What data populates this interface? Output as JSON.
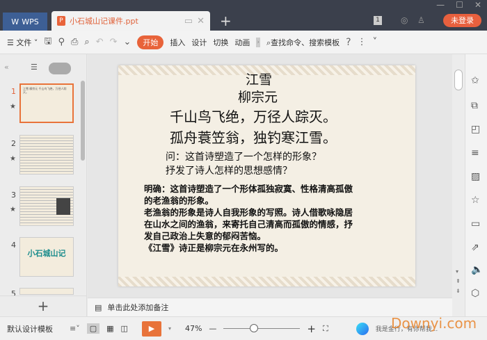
{
  "titlebar": {
    "wps_label": "WPS",
    "doc_name": "小石城山记课件.ppt",
    "badge": "1",
    "login": "未登录"
  },
  "toolbar": {
    "file": "文件",
    "start": "开始",
    "insert": "插入",
    "design": "设计",
    "transition": "切换",
    "animation": "动画",
    "search": "查找命令、搜索模板",
    "help": "?"
  },
  "slides_pane": {
    "thumbnails": [
      {
        "num": "1",
        "text": "江雪 柳宗元 千山鸟飞绝，万径人踪灭。"
      },
      {
        "num": "2",
        "text": ""
      },
      {
        "num": "3",
        "text": ""
      },
      {
        "num": "4",
        "text": "小石城山记"
      }
    ],
    "next_num": "5",
    "add": "+"
  },
  "slide": {
    "title": "江雪",
    "author": "柳宗元",
    "line1": "千山鸟飞绝，万径人踪灭。",
    "line2": "孤舟蓑笠翁，独钓寒江雪。",
    "q1": "问：这首诗塑造了一个怎样的形象？",
    "q2": "抒发了诗人怎样的思想感情？",
    "a1": "明确：这首诗塑造了一个形体孤独寂寞、性格清高孤傲",
    "a2": "的老渔翁的形象。",
    "a3": "老渔翁的形象是诗人自我形象的写照。诗人借歌咏隐居",
    "a4": "在山水之间的渔翁，来寄托自己清高而孤傲的情感，抒",
    "a5": "发自己政治上失意的郁闷苦恼。",
    "a6": "《江雪》诗正是柳宗元在永州写的。"
  },
  "notes": {
    "placeholder": "单击此处添加备注"
  },
  "status": {
    "template": "默认设计模板",
    "zoom": "47%",
    "assistant": "我是金行，有你帮我...",
    "watermark": "Downyi.com"
  },
  "colors": {
    "accent": "#e8633a",
    "titlebar": "#3b404c"
  }
}
